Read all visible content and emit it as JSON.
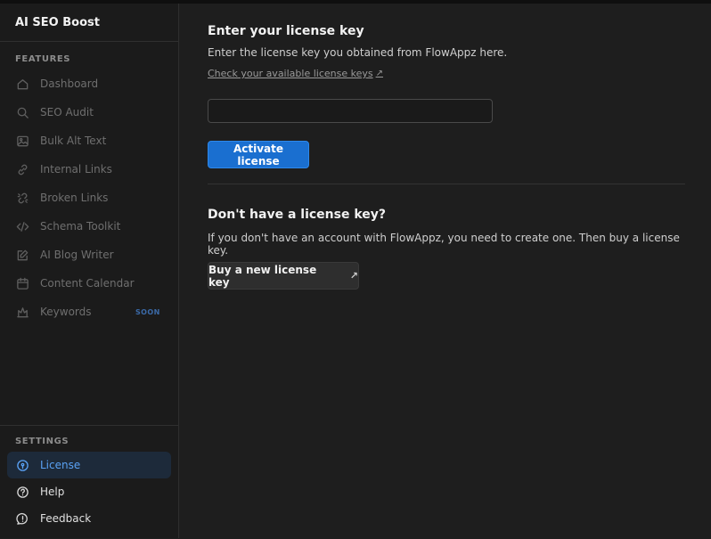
{
  "app": {
    "title": "AI SEO Boost"
  },
  "sidebar": {
    "features_label": "FEATURES",
    "items": [
      {
        "label": "Dashboard",
        "icon": "home-icon"
      },
      {
        "label": "SEO Audit",
        "icon": "search-icon"
      },
      {
        "label": "Bulk Alt Text",
        "icon": "image-icon"
      },
      {
        "label": "Internal Links",
        "icon": "link-icon"
      },
      {
        "label": "Broken Links",
        "icon": "broken-link-icon"
      },
      {
        "label": "Schema Toolkit",
        "icon": "code-icon"
      },
      {
        "label": "AI Blog Writer",
        "icon": "pencil-icon"
      },
      {
        "label": "Content Calendar",
        "icon": "calendar-icon"
      },
      {
        "label": "Keywords",
        "icon": "crown-icon",
        "badge": "SOON"
      }
    ],
    "settings_label": "SETTINGS",
    "settings_items": [
      {
        "label": "License",
        "icon": "license-icon",
        "active": true
      },
      {
        "label": "Help",
        "icon": "help-icon"
      },
      {
        "label": "Feedback",
        "icon": "feedback-icon"
      }
    ]
  },
  "license": {
    "title": "Enter your license key",
    "description": "Enter the license key you obtained from FlowAppz here.",
    "link_text": "Check your available license keys",
    "input_value": "",
    "input_placeholder": "",
    "activate_label": "Activate license"
  },
  "no_key": {
    "title": "Don't have a license key?",
    "description": "If you don't have an account with FlowAppz, you need to create one. Then buy a license key.",
    "buy_label": "Buy a new license key"
  },
  "colors": {
    "accent": "#1a6fd0",
    "active_text": "#5aa2f5",
    "background": "#1e1e1e",
    "sidebar_bg": "#1b1b1b"
  }
}
